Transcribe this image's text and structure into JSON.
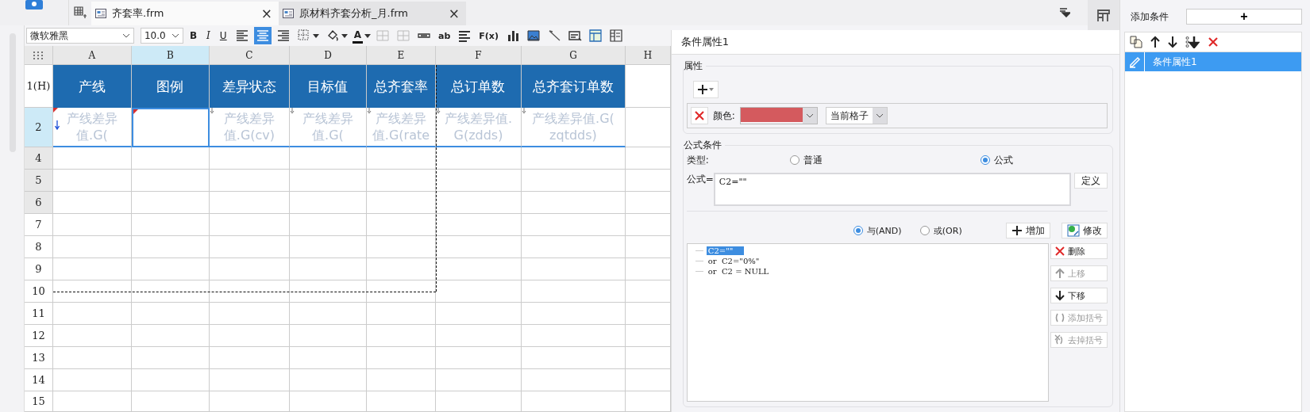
{
  "tabs": [
    {
      "label": "齐套率.frm",
      "close": "×",
      "selected": true
    },
    {
      "label": "原材料齐套分析_月.frm",
      "close": "×",
      "selected": false
    }
  ],
  "toolbar": [
    {
      "kind": "font",
      "value": "微软雅黑"
    },
    {
      "kind": "size",
      "value": "10.0"
    },
    {
      "kind": "bold",
      "label": "B"
    },
    {
      "kind": "italic",
      "label": "I"
    },
    {
      "kind": "underline",
      "label": "U"
    },
    {
      "kind": "align-left",
      "selected": false
    },
    {
      "kind": "align-center",
      "selected": true
    },
    {
      "kind": "align-right",
      "selected": false
    },
    {
      "kind": "border"
    },
    {
      "kind": "fill"
    },
    {
      "kind": "font-color",
      "label": "A"
    },
    {
      "kind": "merge"
    },
    {
      "kind": "unmerge"
    },
    {
      "kind": "textbox"
    },
    {
      "kind": "text",
      "label": "ab"
    },
    {
      "kind": "lines"
    },
    {
      "kind": "text",
      "label": "F(x)"
    },
    {
      "kind": "chart"
    },
    {
      "kind": "image"
    },
    {
      "kind": "slash"
    },
    {
      "kind": "widget"
    },
    {
      "kind": "panel"
    },
    {
      "kind": "columns"
    }
  ],
  "sheet": {
    "columns": [
      {
        "label": "A",
        "selected": false
      },
      {
        "label": "B",
        "selected": true
      },
      {
        "label": "C",
        "selected": false
      },
      {
        "label": "D",
        "selected": false
      },
      {
        "label": "E",
        "selected": false
      },
      {
        "label": "F",
        "selected": false
      },
      {
        "label": "G",
        "selected": false
      },
      {
        "label": "H",
        "selected": false
      }
    ],
    "header_row": {
      "label": "1(H)",
      "cells": [
        "产线",
        "图例",
        "差异状态",
        "目标值",
        "总齐套率",
        "总订单数",
        "总齐套订单数"
      ]
    },
    "data_row": {
      "label": "2",
      "selected": true,
      "cells": [
        {
          "lines": [
            "产线差异",
            "值.G("
          ],
          "flagged": true,
          "expand_arrow": true,
          "selected": false
        },
        {
          "flagged": true,
          "expand_arrow": false,
          "selected": true
        },
        {
          "lines": [
            "产线差异",
            "值.G(cv)"
          ],
          "flagged": false,
          "expand_arrow": false,
          "selected": false
        },
        {
          "lines": [
            "产线差异",
            "值.G("
          ],
          "flagged": false,
          "expand_arrow": false,
          "selected": false
        },
        {
          "lines": [
            "产线差异",
            "值.G(rate"
          ],
          "flagged": false,
          "expand_arrow": false,
          "selected": false
        },
        {
          "lines": [
            "产线差异值.",
            "G(zdds)"
          ],
          "flagged": false,
          "expand_arrow": false,
          "selected": false
        },
        {
          "lines": [
            "产线差异值.G(",
            "zqtdds)"
          ],
          "flagged": false,
          "expand_arrow": false,
          "selected": false
        }
      ]
    },
    "row_numbers": [
      "4",
      "5",
      "6",
      "7",
      "8",
      "9",
      "10",
      "11",
      "12",
      "13",
      "14",
      "15"
    ]
  },
  "condition_panel": {
    "title": "条件属性1",
    "attributes": {
      "legend": "属性",
      "color_label": "颜色:",
      "color": "#d45a5e",
      "scope": "当前格子"
    },
    "formula_condition": {
      "legend": "公式条件",
      "type_label": "类型:",
      "types": [
        {
          "label": "普通",
          "selected": false
        },
        {
          "label": "公式",
          "selected": true
        }
      ],
      "formula_label": "公式=",
      "formula": "C2=\"\"",
      "define_button": "定义",
      "logic": [
        {
          "label": "与(AND)",
          "selected": true
        },
        {
          "label": "或(OR)",
          "selected": false
        }
      ],
      "add_button": "增加",
      "modify_button": "修改",
      "conditions": [
        {
          "text": "C2=\"\"",
          "selected": true
        },
        {
          "text": "or  C2=\"0%\"",
          "selected": false
        },
        {
          "text": "or  C2 = NULL",
          "selected": false
        }
      ],
      "side_buttons": [
        {
          "kind": "delete",
          "label": "删除",
          "disabled": false
        },
        {
          "kind": "up",
          "label": "上移",
          "disabled": true
        },
        {
          "kind": "down",
          "label": "下移",
          "disabled": false
        },
        {
          "kind": "add-paren",
          "label": "添加括号",
          "disabled": true
        },
        {
          "kind": "remove-paren",
          "label": "去掉括号",
          "disabled": true
        }
      ]
    }
  },
  "conditions_list": {
    "label": "添加条件",
    "add": "+",
    "items": [
      {
        "label": "条件属性1",
        "selected": true
      }
    ]
  }
}
